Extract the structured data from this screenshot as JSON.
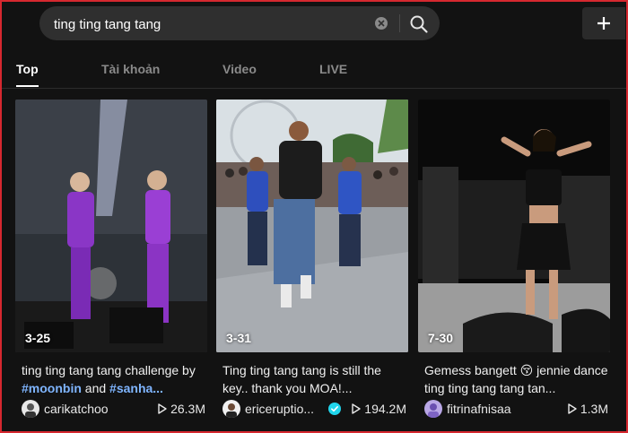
{
  "search": {
    "value": "ting ting tang tang"
  },
  "tabs": [
    "Top",
    "Tài khoản",
    "Video",
    "LIVE"
  ],
  "videos": [
    {
      "date": "3-25",
      "caption_text": "ting ting tang tang challenge by ",
      "hashtags": [
        "#moonbin",
        "#sanha..."
      ],
      "caption_join": " and ",
      "author": "carikatchoo",
      "views": "26.3M"
    },
    {
      "date": "3-31",
      "caption": "Ting ting tang tang is still the key.. thank you MOA!...",
      "author": "ericeruptio...",
      "verified": true,
      "views": "194.2M"
    },
    {
      "date": "7-30",
      "caption_text": "Gemess bangett",
      "emoji": "😚",
      "caption_rest": "jennie dance ting ting tang tang tan...",
      "author": "fitrinafnisaa",
      "views": "1.3M"
    }
  ],
  "colors": {
    "background": "#121212",
    "search_bg": "#2f2f2f",
    "hashtag": "#7fb5ff",
    "verified": "#20d5ec",
    "frame": "#d6282f"
  }
}
